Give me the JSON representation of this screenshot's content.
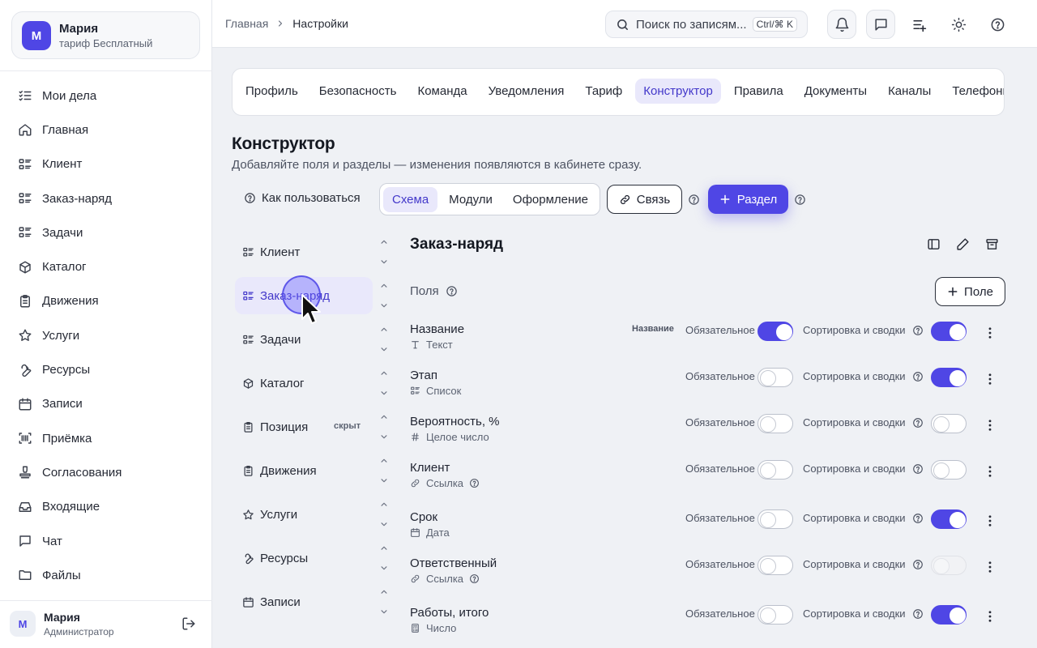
{
  "account": {
    "avatar": "М",
    "name": "Мария",
    "plan": "тариф Бесплатный"
  },
  "nav": [
    {
      "label": "Мои дела",
      "icon": "checklist-icon"
    },
    {
      "label": "Главная",
      "icon": "home-icon"
    },
    {
      "label": "Клиент",
      "icon": "list-icon"
    },
    {
      "label": "Заказ-наряд",
      "icon": "list-icon"
    },
    {
      "label": "Задачи",
      "icon": "list-icon"
    },
    {
      "label": "Каталог",
      "icon": "box-icon"
    },
    {
      "label": "Движения",
      "icon": "clipboard-icon"
    },
    {
      "label": "Услуги",
      "icon": "star-icon"
    },
    {
      "label": "Ресурсы",
      "icon": "wrench-icon"
    },
    {
      "label": "Записи",
      "icon": "calendar-icon"
    },
    {
      "label": "Приёмка",
      "icon": "barcode-scan-icon"
    },
    {
      "label": "Согласования",
      "icon": "stamp-icon"
    },
    {
      "label": "Входящие",
      "icon": "inbox-icon"
    },
    {
      "label": "Чат",
      "icon": "chat-icon"
    },
    {
      "label": "Файлы",
      "icon": "folder-icon"
    }
  ],
  "user": {
    "avatar": "М",
    "name": "Мария",
    "role": "Администратор"
  },
  "topbar": {
    "breadcrumb": [
      "Главная",
      "Настройки"
    ],
    "search_placeholder": "Поиск по записям",
    "search_shortcut": "Ctrl/⌘ K"
  },
  "tabs": [
    "Профиль",
    "Безопасность",
    "Команда",
    "Уведомления",
    "Тариф",
    "Конструктор",
    "Правила",
    "Документы",
    "Каналы",
    "Телефония"
  ],
  "active_tab": "Конструктор",
  "page": {
    "title": "Конструктор",
    "subtitle": "Добавляйте поля и разделы — изменения появляются в кабинете сразу.",
    "howto": "Как пользоваться",
    "views": [
      "Схема",
      "Модули",
      "Оформление"
    ],
    "active_view": "Схема",
    "link_button": "Связь",
    "add_section_button": "Раздел"
  },
  "sections": [
    {
      "label": "Клиент",
      "icon": "list-icon"
    },
    {
      "label": "Заказ-наряд",
      "icon": "list-icon",
      "active": true
    },
    {
      "label": "Задачи",
      "icon": "list-icon"
    },
    {
      "label": "Каталог",
      "icon": "box-icon"
    },
    {
      "label": "Позиция",
      "icon": "clipboard-icon",
      "badge": "скрыт"
    },
    {
      "label": "Движения",
      "icon": "clipboard-icon"
    },
    {
      "label": "Услуги",
      "icon": "star-icon"
    },
    {
      "label": "Ресурсы",
      "icon": "wrench-icon"
    },
    {
      "label": "Записи",
      "icon": "calendar-icon"
    }
  ],
  "panel": {
    "title": "Заказ-наряд",
    "fields_label": "Поля",
    "add_field_button": "Поле",
    "required_label": "Обязательное",
    "sort_label": "Сортировка и сводки",
    "fields": [
      {
        "name": "Название",
        "type": "Текст",
        "type_icon": "text-icon",
        "badge": "Название",
        "required": true,
        "sortable": true
      },
      {
        "name": "Этап",
        "type": "Список",
        "type_icon": "list-icon",
        "required": false,
        "sortable": true
      },
      {
        "name": "Вероятность, %",
        "type": "Целое число",
        "type_icon": "hash-icon",
        "required": false,
        "sortable": false
      },
      {
        "name": "Клиент",
        "type": "Ссылка",
        "type_icon": "link-icon",
        "required": false,
        "sortable": false,
        "help": true
      },
      {
        "name": "Срок",
        "type": "Дата",
        "type_icon": "calendar-icon",
        "required": false,
        "sortable": true
      },
      {
        "name": "Ответственный",
        "type": "Ссылка",
        "type_icon": "link-icon",
        "required": false,
        "sortable": false,
        "sort_disabled": true,
        "help": true
      },
      {
        "name": "Работы, итого",
        "type": "Число",
        "type_icon": "calculator-icon",
        "required": false,
        "sortable": true
      }
    ]
  },
  "colors": {
    "accent": "#4f46e5",
    "accent_soft": "#e9e8fb",
    "background": "#eff1f5"
  }
}
